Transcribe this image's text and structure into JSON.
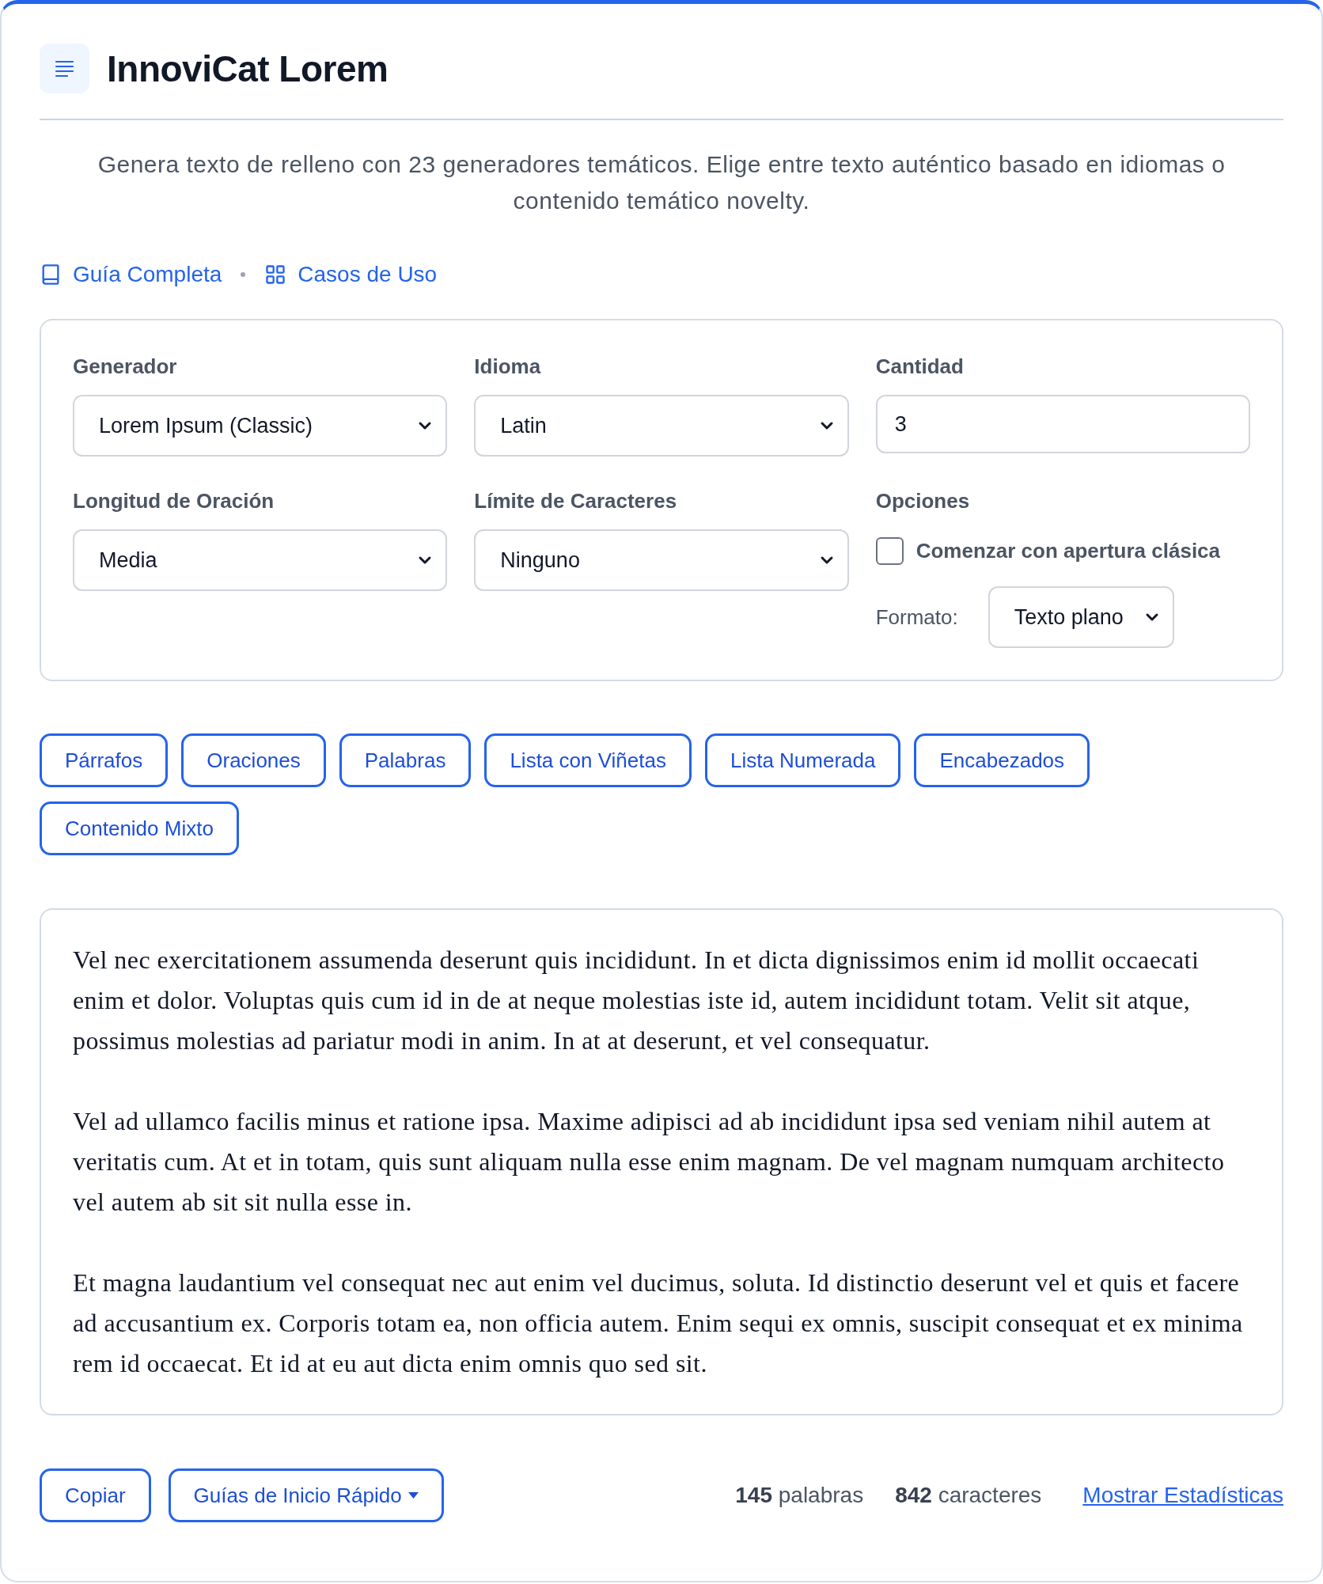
{
  "header": {
    "title": "InnoviCat Lorem"
  },
  "description": "Genera texto de relleno con 23 generadores temáticos. Elige entre texto auténtico basado en idiomas o contenido temático novelty.",
  "links": [
    {
      "label": "Guía Completa",
      "kind": "book"
    },
    {
      "label": "Casos de Uso",
      "kind": "grid"
    }
  ],
  "form": {
    "fields": [
      {
        "label": "Generador",
        "kind": "select",
        "value": "Lorem Ipsum (Classic)"
      },
      {
        "label": "Idioma",
        "kind": "select",
        "value": "Latin"
      },
      {
        "label": "Cantidad",
        "kind": "input",
        "value": "3"
      },
      {
        "label": "Longitud de Oración",
        "kind": "select",
        "value": "Media"
      },
      {
        "label": "Límite de Caracteres",
        "kind": "select",
        "value": "Ninguno"
      }
    ],
    "options": {
      "label": "Opciones",
      "checkbox": {
        "label": "Comenzar con apertura clásica",
        "checked": false
      },
      "format": {
        "label": "Formato:",
        "value": "Texto plano"
      }
    }
  },
  "mode_buttons": [
    "Párrafos",
    "Oraciones",
    "Palabras",
    "Lista con Viñetas",
    "Lista Numerada",
    "Encabezados",
    "Contenido Mixto"
  ],
  "output": {
    "paragraphs": [
      "Vel nec exercitationem assumenda deserunt quis incididunt. In et dicta dignissimos enim id mollit occaecati enim et dolor. Voluptas quis cum id in de at neque molestias iste id, autem incididunt totam. Velit sit atque, possimus molestias ad pariatur modi in anim. In at at deserunt, et vel consequatur.",
      "Vel ad ullamco facilis minus et ratione ipsa. Maxime adipisci ad ab incididunt ipsa sed veniam nihil autem at veritatis cum. At et in totam, quis sunt aliquam nulla esse enim magnam. De vel magnam numquam architecto vel autem ab sit sit nulla esse in.",
      "Et magna laudantium vel consequat nec aut enim vel ducimus, soluta. Id distinctio deserunt vel et quis et facere ad accusantium ex. Corporis totam ea, non officia autem. Enim sequi ex omnis, suscipit consequat et ex minima rem id occaecat. Et id at eu aut dicta enim omnis quo sed sit."
    ]
  },
  "footer": {
    "buttons": [
      {
        "label": "Copiar",
        "kind": "plain"
      },
      {
        "label": "Guías de Inicio Rápido",
        "kind": "dropdown"
      }
    ],
    "stats": [
      "**145** palabras",
      "**842** caracteres"
    ],
    "link": "Mostrar Estadísticas"
  }
}
